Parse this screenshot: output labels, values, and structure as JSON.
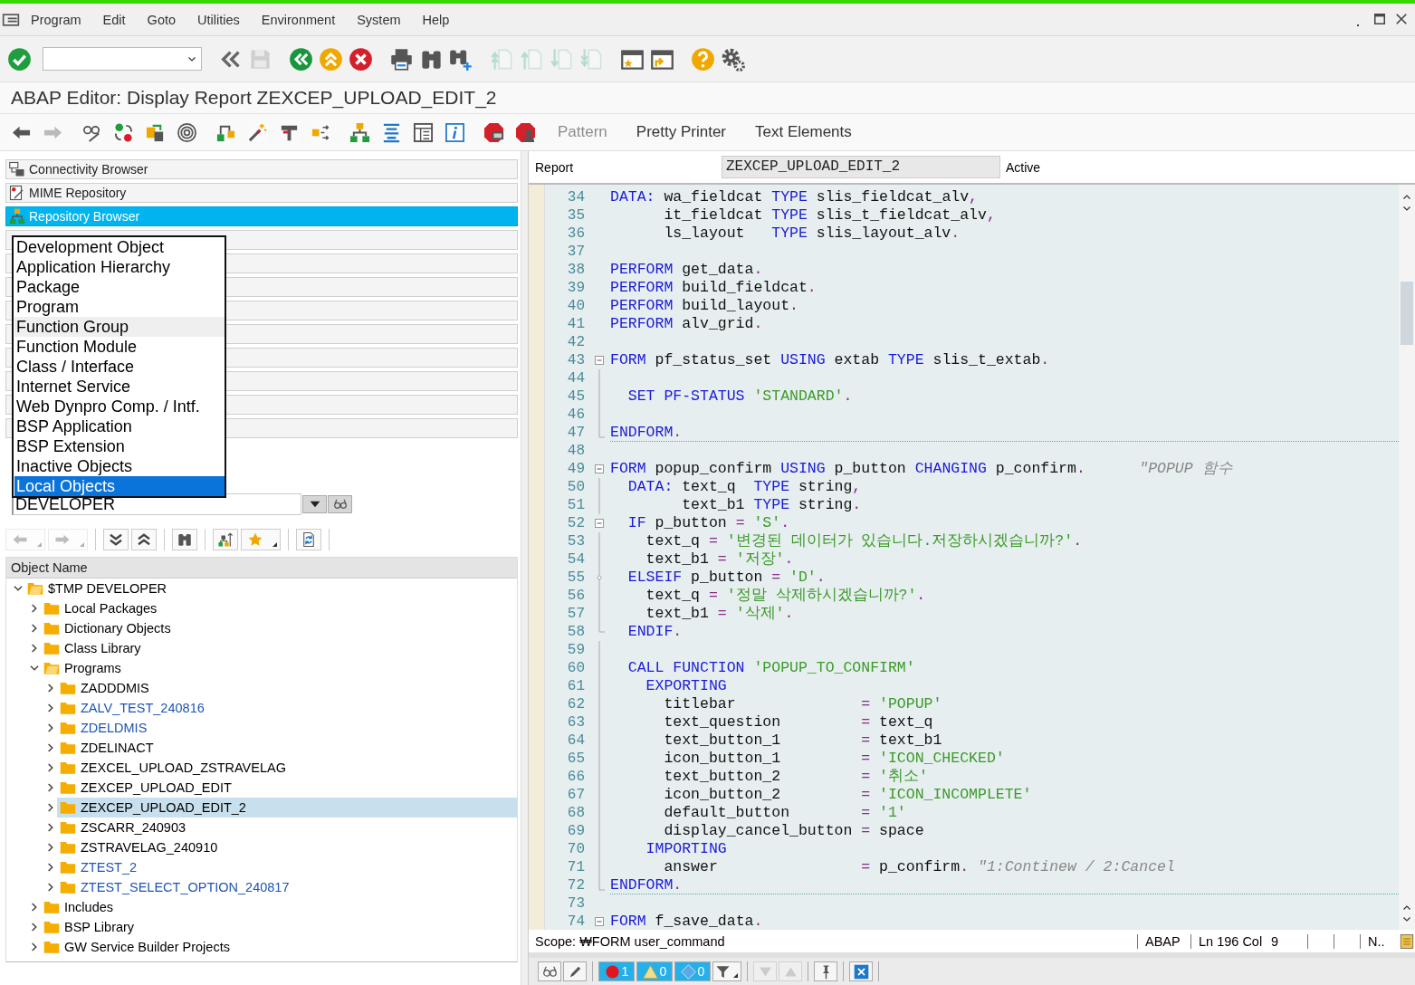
{
  "menu_bar": {
    "items": [
      "Program",
      "Edit",
      "Goto",
      "Utilities",
      "Environment",
      "System",
      "Help"
    ],
    "window_controls": [
      {
        "kind": "minimize"
      },
      {
        "kind": "maximize"
      },
      {
        "kind": "close"
      }
    ]
  },
  "standard_toolbar": [
    [
      {
        "kind": "enter",
        "disabled": false
      },
      {
        "kind": "command",
        "disabled": false
      }
    ],
    [
      {
        "kind": "collapse",
        "disabled": false
      },
      {
        "kind": "save",
        "disabled": true
      }
    ],
    [
      {
        "kind": "back",
        "disabled": false
      },
      {
        "kind": "exit",
        "disabled": false
      },
      {
        "kind": "cancel",
        "disabled": false
      }
    ],
    [
      {
        "kind": "print",
        "disabled": false
      },
      {
        "kind": "find",
        "disabled": false
      },
      {
        "kind": "find-next",
        "disabled": false
      }
    ],
    [
      {
        "kind": "first-page",
        "disabled": true
      },
      {
        "kind": "previous-page",
        "disabled": true
      },
      {
        "kind": "next-page",
        "disabled": true
      },
      {
        "kind": "last-page",
        "disabled": true
      }
    ],
    [
      {
        "kind": "new-session",
        "disabled": false
      },
      {
        "kind": "shortcut",
        "disabled": false
      }
    ],
    [
      {
        "kind": "help",
        "disabled": false
      },
      {
        "kind": "customize",
        "disabled": false
      }
    ]
  ],
  "title": "ABAP Editor: Display Report ZEXCEP_UPLOAD_EDIT_2",
  "application_toolbar": [
    [
      {
        "kind": "arrow-left",
        "disabled": false
      },
      {
        "kind": "arrow-right",
        "disabled": true
      }
    ],
    [
      {
        "kind": "glasses",
        "disabled": false
      },
      {
        "kind": "swap",
        "disabled": false
      },
      {
        "kind": "objects",
        "disabled": false
      },
      {
        "kind": "spiral",
        "disabled": false
      }
    ],
    [
      {
        "kind": "hierarchy",
        "disabled": false
      },
      {
        "kind": "wand",
        "disabled": false
      },
      {
        "kind": "stamp",
        "disabled": false
      },
      {
        "kind": "split",
        "disabled": false
      }
    ],
    [
      {
        "kind": "tree",
        "disabled": false
      },
      {
        "kind": "align",
        "disabled": false
      },
      {
        "kind": "frame",
        "disabled": false
      },
      {
        "kind": "info",
        "disabled": false
      }
    ],
    [
      {
        "kind": "stop-monitor",
        "disabled": false
      },
      {
        "kind": "stop-person",
        "disabled": false
      }
    ],
    [
      {
        "kind": "text",
        "label": "Pattern",
        "disabled": true
      },
      {
        "kind": "text",
        "label": "Pretty Printer",
        "disabled": false
      },
      {
        "kind": "text",
        "label": "Text Elements",
        "disabled": false
      }
    ]
  ],
  "navigation": [
    {
      "kind": "connectivity",
      "label": "Connectivity Browser",
      "selected": false
    },
    {
      "kind": "mime",
      "label": "MIME Repository",
      "selected": false
    },
    {
      "kind": "repository",
      "label": "Repository Browser",
      "selected": true
    },
    {
      "kind": "covered",
      "selected": false
    },
    {
      "kind": "covered",
      "selected": false
    },
    {
      "kind": "covered",
      "selected": false
    },
    {
      "kind": "covered",
      "selected": false
    },
    {
      "kind": "covered",
      "selected": false
    },
    {
      "kind": "covered",
      "selected": false
    },
    {
      "kind": "covered",
      "selected": false
    },
    {
      "kind": "covered",
      "selected": false
    },
    {
      "kind": "covered",
      "selected": false
    }
  ],
  "object_list_dropdown": [
    {
      "label": "Development Object",
      "selected": false,
      "hovered": false
    },
    {
      "label": "Application Hierarchy",
      "selected": false,
      "hovered": false
    },
    {
      "label": "Package",
      "selected": false,
      "hovered": false
    },
    {
      "label": "Program",
      "selected": false,
      "hovered": false
    },
    {
      "label": "Function Group",
      "selected": false,
      "hovered": true
    },
    {
      "label": "Function Module",
      "selected": false,
      "hovered": false
    },
    {
      "label": "Class / Interface",
      "selected": false,
      "hovered": false
    },
    {
      "label": "Internet Service",
      "selected": false,
      "hovered": false
    },
    {
      "label": "Web Dynpro Comp. / Intf.",
      "selected": false,
      "hovered": false
    },
    {
      "label": "BSP Application",
      "selected": false,
      "hovered": false
    },
    {
      "label": "BSP Extension",
      "selected": false,
      "hovered": false
    },
    {
      "label": "Inactive Objects",
      "selected": false,
      "hovered": false
    },
    {
      "label": "Local Objects",
      "selected": true,
      "hovered": false
    }
  ],
  "object_field": {
    "value": "DEVELOPER"
  },
  "tree_toolbar": [
    [
      {
        "kind": "arrow-left",
        "disabled": true,
        "menu": true
      },
      {
        "kind": "arrow-right",
        "disabled": true,
        "menu": true
      }
    ],
    [
      {
        "kind": "expand-all",
        "disabled": false,
        "menu": false
      },
      {
        "kind": "collapse-all",
        "disabled": false,
        "menu": false
      }
    ],
    [
      {
        "kind": "find",
        "disabled": false,
        "menu": false
      }
    ],
    [
      {
        "kind": "hierarchy-up",
        "disabled": false,
        "menu": false
      },
      {
        "kind": "star",
        "disabled": false,
        "menu": true
      }
    ],
    [
      {
        "kind": "refresh",
        "disabled": false,
        "menu": false
      }
    ]
  ],
  "tree": {
    "header": "Object Name",
    "nodes": [
      {
        "label": "$TMP DEVELOPER",
        "expanded": true,
        "selected": false,
        "color": "#000000",
        "children": [
          {
            "label": "Local Packages",
            "expanded": false,
            "selected": false,
            "color": "#000000"
          },
          {
            "label": "Dictionary Objects",
            "expanded": false,
            "selected": false,
            "color": "#000000"
          },
          {
            "label": "Class Library",
            "expanded": false,
            "selected": false,
            "color": "#000000"
          },
          {
            "label": "Programs",
            "expanded": true,
            "selected": false,
            "color": "#000000",
            "children": [
              {
                "label": "ZADDDMIS",
                "expanded": false,
                "selected": false,
                "color": "#000000"
              },
              {
                "label": "ZALV_TEST_240816",
                "expanded": false,
                "selected": false,
                "color": "#1f55b0"
              },
              {
                "label": "ZDELDMIS",
                "expanded": false,
                "selected": false,
                "color": "#1f55b0"
              },
              {
                "label": "ZDELINACT",
                "expanded": false,
                "selected": false,
                "color": "#000000"
              },
              {
                "label": "ZEXCEL_UPLOAD_ZSTRAVELAG",
                "expanded": false,
                "selected": false,
                "color": "#000000"
              },
              {
                "label": "ZEXCEP_UPLOAD_EDIT",
                "expanded": false,
                "selected": false,
                "color": "#000000"
              },
              {
                "label": "ZEXCEP_UPLOAD_EDIT_2",
                "expanded": false,
                "selected": true,
                "color": "#000000"
              },
              {
                "label": "ZSCARR_240903",
                "expanded": false,
                "selected": false,
                "color": "#000000"
              },
              {
                "label": "ZSTRAVELAG_240910",
                "expanded": false,
                "selected": false,
                "color": "#000000"
              },
              {
                "label": "ZTEST_2",
                "expanded": false,
                "selected": false,
                "color": "#1f55b0"
              },
              {
                "label": "ZTEST_SELECT_OPTION_240817",
                "expanded": false,
                "selected": false,
                "color": "#1f55b0"
              }
            ]
          },
          {
            "label": "Includes",
            "expanded": false,
            "selected": false,
            "color": "#000000"
          },
          {
            "label": "BSP Library",
            "expanded": false,
            "selected": false,
            "color": "#000000"
          },
          {
            "label": "GW Service Builder Projects",
            "expanded": false,
            "selected": false,
            "color": "#000000"
          }
        ]
      }
    ]
  },
  "report": {
    "label": "Report",
    "name": "ZEXCEP_UPLOAD_EDIT_2",
    "status": "Active"
  },
  "code_lines": [
    {
      "no": "34",
      "kind": "plain",
      "tokens": [
        {
          "kind": "keyword",
          "text": "DATA:"
        },
        {
          "kind": "ident",
          "text": " wa_fieldcat "
        },
        {
          "kind": "keyword",
          "text": "TYPE"
        },
        {
          "kind": "ident",
          "text": " slis_fieldcat_alv"
        },
        {
          "kind": "punct",
          "text": ","
        }
      ]
    },
    {
      "no": "35",
      "kind": "plain",
      "tokens": [
        {
          "kind": "ident",
          "text": "      it_fieldcat "
        },
        {
          "kind": "keyword",
          "text": "TYPE"
        },
        {
          "kind": "ident",
          "text": " slis_t_fieldcat_alv"
        },
        {
          "kind": "punct",
          "text": ","
        }
      ]
    },
    {
      "no": "36",
      "kind": "plain",
      "tokens": [
        {
          "kind": "ident",
          "text": "      ls_layout   "
        },
        {
          "kind": "keyword",
          "text": "TYPE"
        },
        {
          "kind": "ident",
          "text": " slis_layout_alv"
        },
        {
          "kind": "punct",
          "text": "."
        }
      ]
    },
    {
      "no": "37",
      "kind": "plain"
    },
    {
      "no": "38",
      "kind": "plain",
      "tokens": [
        {
          "kind": "keyword",
          "text": "PERFORM"
        },
        {
          "kind": "ident",
          "text": " get_data"
        },
        {
          "kind": "punct",
          "text": "."
        }
      ]
    },
    {
      "no": "39",
      "kind": "plain",
      "tokens": [
        {
          "kind": "keyword",
          "text": "PERFORM"
        },
        {
          "kind": "ident",
          "text": " build_fieldcat"
        },
        {
          "kind": "punct",
          "text": "."
        }
      ]
    },
    {
      "no": "40",
      "kind": "plain",
      "tokens": [
        {
          "kind": "keyword",
          "text": "PERFORM"
        },
        {
          "kind": "ident",
          "text": " build_layout"
        },
        {
          "kind": "punct",
          "text": "."
        }
      ]
    },
    {
      "no": "41",
      "kind": "plain",
      "tokens": [
        {
          "kind": "keyword",
          "text": "PERFORM"
        },
        {
          "kind": "ident",
          "text": " alv_grid"
        },
        {
          "kind": "punct",
          "text": "."
        }
      ]
    },
    {
      "no": "42",
      "kind": "plain"
    },
    {
      "no": "43",
      "kind": "fold-start",
      "tokens": [
        {
          "kind": "keyword",
          "text": "FORM"
        },
        {
          "kind": "ident",
          "text": " pf_status_set "
        },
        {
          "kind": "keyword",
          "text": "USING"
        },
        {
          "kind": "ident",
          "text": " extab "
        },
        {
          "kind": "keyword",
          "text": "TYPE"
        },
        {
          "kind": "ident",
          "text": " slis_t_extab"
        },
        {
          "kind": "punct",
          "text": "."
        }
      ]
    },
    {
      "no": "44",
      "kind": "fold-inside"
    },
    {
      "no": "45",
      "kind": "fold-inside",
      "tokens": [
        {
          "kind": "keyword",
          "text": "  SET PF-STATUS"
        },
        {
          "kind": "string",
          "text": " 'STANDARD'"
        },
        {
          "kind": "punct",
          "text": "."
        }
      ]
    },
    {
      "no": "46",
      "kind": "fold-inside"
    },
    {
      "no": "47",
      "kind": "block-end",
      "tokens": [
        {
          "kind": "keyword",
          "text": "ENDFORM"
        },
        {
          "kind": "punct",
          "text": "."
        }
      ]
    },
    {
      "no": "48",
      "kind": "plain"
    },
    {
      "no": "49",
      "kind": "fold-start",
      "tokens": [
        {
          "kind": "keyword",
          "text": "FORM"
        },
        {
          "kind": "ident",
          "text": " popup_confirm "
        },
        {
          "kind": "keyword",
          "text": "USING"
        },
        {
          "kind": "ident",
          "text": " p_button "
        },
        {
          "kind": "keyword",
          "text": "CHANGING"
        },
        {
          "kind": "ident",
          "text": " p_confirm"
        },
        {
          "kind": "punct",
          "text": "."
        },
        {
          "kind": "comment",
          "text": "      \"POPUP 함수"
        }
      ]
    },
    {
      "no": "50",
      "kind": "fold-inside",
      "tokens": [
        {
          "kind": "keyword",
          "text": "  DATA:"
        },
        {
          "kind": "ident",
          "text": " text_q  "
        },
        {
          "kind": "keyword",
          "text": "TYPE"
        },
        {
          "kind": "ident",
          "text": " string"
        },
        {
          "kind": "punct",
          "text": ","
        }
      ]
    },
    {
      "no": "51",
      "kind": "fold-inside",
      "tokens": [
        {
          "kind": "ident",
          "text": "        text_b1 "
        },
        {
          "kind": "keyword",
          "text": "TYPE"
        },
        {
          "kind": "ident",
          "text": " string"
        },
        {
          "kind": "punct",
          "text": "."
        }
      ]
    },
    {
      "no": "52",
      "kind": "fold-start",
      "tokens": [
        {
          "kind": "keyword",
          "text": "  IF"
        },
        {
          "kind": "ident",
          "text": " p_button "
        },
        {
          "kind": "punct",
          "text": "="
        },
        {
          "kind": "string",
          "text": " 'S'"
        },
        {
          "kind": "punct",
          "text": "."
        }
      ]
    },
    {
      "no": "53",
      "kind": "fold-inside",
      "tokens": [
        {
          "kind": "ident",
          "text": "    text_q "
        },
        {
          "kind": "punct",
          "text": "="
        },
        {
          "kind": "string",
          "text": " '변경된 데이터가 있습니다.저장하시겠습니까?'"
        },
        {
          "kind": "punct",
          "text": "."
        }
      ]
    },
    {
      "no": "54",
      "kind": "fold-inside",
      "tokens": [
        {
          "kind": "ident",
          "text": "    text_b1 "
        },
        {
          "kind": "punct",
          "text": "="
        },
        {
          "kind": "string",
          "text": " '저장'"
        },
        {
          "kind": "punct",
          "text": "."
        }
      ]
    },
    {
      "no": "55",
      "kind": "fold-branch",
      "tokens": [
        {
          "kind": "keyword",
          "text": "  ELSEIF"
        },
        {
          "kind": "ident",
          "text": " p_button "
        },
        {
          "kind": "punct",
          "text": "="
        },
        {
          "kind": "string",
          "text": " 'D'"
        },
        {
          "kind": "punct",
          "text": "."
        }
      ]
    },
    {
      "no": "56",
      "kind": "fold-inside",
      "tokens": [
        {
          "kind": "ident",
          "text": "    text_q "
        },
        {
          "kind": "punct",
          "text": "="
        },
        {
          "kind": "string",
          "text": " '정말 삭제하시겠습니까?'"
        },
        {
          "kind": "punct",
          "text": "."
        }
      ]
    },
    {
      "no": "57",
      "kind": "fold-inside",
      "tokens": [
        {
          "kind": "ident",
          "text": "    text_b1 "
        },
        {
          "kind": "punct",
          "text": "="
        },
        {
          "kind": "string",
          "text": " '삭제'"
        },
        {
          "kind": "punct",
          "text": "."
        }
      ]
    },
    {
      "no": "58",
      "kind": "fold-end",
      "tokens": [
        {
          "kind": "keyword",
          "text": "  ENDIF"
        },
        {
          "kind": "punct",
          "text": "."
        }
      ]
    },
    {
      "no": "59",
      "kind": "fold-inside"
    },
    {
      "no": "60",
      "kind": "fold-inside",
      "tokens": [
        {
          "kind": "keyword",
          "text": "  CALL FUNCTION"
        },
        {
          "kind": "string",
          "text": " 'POPUP_TO_CONFIRM'"
        }
      ]
    },
    {
      "no": "61",
      "kind": "fold-inside",
      "tokens": [
        {
          "kind": "keyword",
          "text": "    EXPORTING"
        }
      ]
    },
    {
      "no": "62",
      "kind": "fold-inside",
      "tokens": [
        {
          "kind": "ident",
          "text": "      titlebar              "
        },
        {
          "kind": "punct",
          "text": "="
        },
        {
          "kind": "string",
          "text": " 'POPUP'"
        }
      ]
    },
    {
      "no": "63",
      "kind": "fold-inside",
      "tokens": [
        {
          "kind": "ident",
          "text": "      text_question         "
        },
        {
          "kind": "punct",
          "text": "="
        },
        {
          "kind": "ident",
          "text": " text_q"
        }
      ]
    },
    {
      "no": "64",
      "kind": "fold-inside",
      "tokens": [
        {
          "kind": "ident",
          "text": "      text_button_1         "
        },
        {
          "kind": "punct",
          "text": "="
        },
        {
          "kind": "ident",
          "text": " text_b1"
        }
      ]
    },
    {
      "no": "65",
      "kind": "fold-inside",
      "tokens": [
        {
          "kind": "ident",
          "text": "      icon_button_1         "
        },
        {
          "kind": "punct",
          "text": "="
        },
        {
          "kind": "string",
          "text": " 'ICON_CHECKED'"
        }
      ]
    },
    {
      "no": "66",
      "kind": "fold-inside",
      "tokens": [
        {
          "kind": "ident",
          "text": "      text_button_2         "
        },
        {
          "kind": "punct",
          "text": "="
        },
        {
          "kind": "string",
          "text": " '취소'"
        }
      ]
    },
    {
      "no": "67",
      "kind": "fold-inside",
      "tokens": [
        {
          "kind": "ident",
          "text": "      icon_button_2         "
        },
        {
          "kind": "punct",
          "text": "="
        },
        {
          "kind": "string",
          "text": " 'ICON_INCOMPLETE'"
        }
      ]
    },
    {
      "no": "68",
      "kind": "fold-inside",
      "tokens": [
        {
          "kind": "ident",
          "text": "      default_button        "
        },
        {
          "kind": "punct",
          "text": "="
        },
        {
          "kind": "string",
          "text": " '1'"
        }
      ]
    },
    {
      "no": "69",
      "kind": "fold-inside",
      "tokens": [
        {
          "kind": "ident",
          "text": "      display_cancel_button "
        },
        {
          "kind": "punct",
          "text": "="
        },
        {
          "kind": "ident",
          "text": " space"
        }
      ]
    },
    {
      "no": "70",
      "kind": "fold-inside",
      "tokens": [
        {
          "kind": "keyword",
          "text": "    IMPORTING"
        }
      ]
    },
    {
      "no": "71",
      "kind": "fold-inside",
      "tokens": [
        {
          "kind": "ident",
          "text": "      answer                "
        },
        {
          "kind": "punct",
          "text": "="
        },
        {
          "kind": "ident",
          "text": " p_confirm"
        },
        {
          "kind": "punct",
          "text": "."
        },
        {
          "kind": "comment",
          "text": " \"1:Continew / 2:Cancel"
        }
      ]
    },
    {
      "no": "72",
      "kind": "block-end",
      "tokens": [
        {
          "kind": "keyword",
          "text": "ENDFORM"
        },
        {
          "kind": "punct",
          "text": "."
        }
      ]
    },
    {
      "no": "73",
      "kind": "plain"
    },
    {
      "no": "74",
      "kind": "fold-start",
      "tokens": [
        {
          "kind": "keyword",
          "text": "FORM"
        },
        {
          "kind": "ident",
          "text": " f_save_data"
        },
        {
          "kind": "punct",
          "text": "."
        }
      ]
    }
  ],
  "status_bar": {
    "scope": "Scope: ₩FORM user_command",
    "language": "ABAP",
    "position": "Ln 196 Col",
    "column": "9",
    "mode": "N.."
  },
  "editor_toolbar": [
    [
      {
        "kind": "display",
        "disabled": false,
        "menu": false
      },
      {
        "kind": "edit",
        "disabled": false,
        "menu": false
      }
    ],
    [
      {
        "kind": "errors",
        "count": "1",
        "disabled": false,
        "menu": false
      },
      {
        "kind": "warnings",
        "count": "0",
        "disabled": false,
        "menu": false
      },
      {
        "kind": "infos",
        "count": "0",
        "disabled": false,
        "menu": false
      },
      {
        "kind": "filter",
        "disabled": false,
        "menu": true
      }
    ],
    [
      {
        "kind": "next",
        "disabled": true,
        "menu": false
      },
      {
        "kind": "previous",
        "disabled": true,
        "menu": false
      }
    ],
    [
      {
        "kind": "pin",
        "disabled": false,
        "menu": false
      }
    ],
    [
      {
        "kind": "close",
        "disabled": false,
        "menu": false
      }
    ]
  ]
}
